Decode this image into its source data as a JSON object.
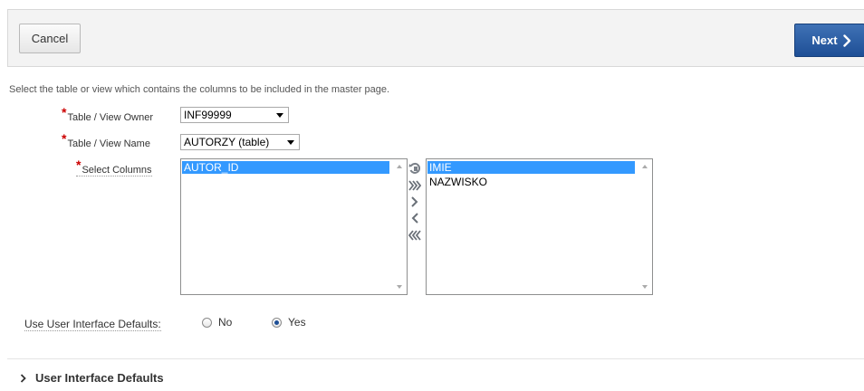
{
  "toolbar": {
    "cancel_label": "Cancel",
    "next_label": "Next"
  },
  "description": "Select the table or view which contains the columns to be included in the master page.",
  "form": {
    "owner": {
      "label": "Table / View Owner",
      "value": "INF99999"
    },
    "table_name": {
      "label": "Table / View Name",
      "value": "AUTORZY (table)"
    },
    "columns": {
      "label": "Select Columns",
      "available": [
        "AUTOR_ID"
      ],
      "selected": [
        "IMIE",
        "NAZWISKO"
      ]
    },
    "ui_defaults": {
      "label": "Use User Interface Defaults:",
      "options": [
        "No",
        "Yes"
      ],
      "value": "Yes"
    }
  },
  "region": {
    "label": "User Interface Defaults"
  },
  "icons": {
    "next": "chevron-right-icon",
    "region_toggle": "chevron-right-icon",
    "shuttle": [
      "reset-icon",
      "move-all-icon",
      "move-icon",
      "remove-icon",
      "remove-all-icon"
    ]
  },
  "colors": {
    "primary": "#1e4f96",
    "required": "#cc0000",
    "selection": "#3399ff"
  }
}
